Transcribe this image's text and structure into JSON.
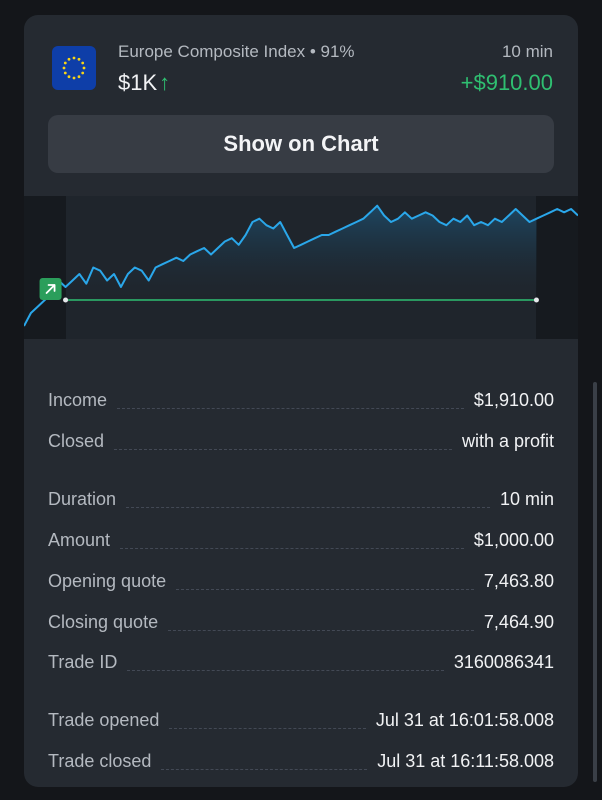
{
  "header": {
    "asset_name": "Europe Composite Index • 91%",
    "duration": "10 min",
    "amount": "$1K",
    "direction_icon": "arrow-up-icon",
    "profit": "+$910.00"
  },
  "show_chart_button": "Show on Chart",
  "chart_data": {
    "type": "line",
    "x": [
      0,
      1,
      2,
      3,
      4,
      5,
      6,
      7,
      8,
      9,
      10,
      11,
      12,
      13,
      14,
      15,
      16,
      17,
      18,
      19,
      20,
      21,
      22,
      23,
      24,
      25,
      26,
      27,
      28,
      29,
      30,
      31,
      32,
      33,
      34,
      35,
      36,
      37,
      38,
      39,
      40,
      41,
      42,
      43,
      44,
      45,
      46,
      47,
      48,
      49,
      50,
      51,
      52,
      53,
      54,
      55,
      56,
      57,
      58,
      59,
      60,
      61,
      62,
      63,
      64,
      65,
      66,
      67,
      68,
      69,
      70,
      71,
      72,
      73,
      74,
      75,
      76,
      77,
      78,
      79,
      80
    ],
    "values": [
      7463.4,
      7463.6,
      7463.7,
      7463.8,
      7463.9,
      7464.1,
      7464.0,
      7464.1,
      7464.2,
      7464.05,
      7464.3,
      7464.25,
      7464.1,
      7464.2,
      7464.0,
      7464.2,
      7464.3,
      7464.25,
      7464.1,
      7464.3,
      7464.35,
      7464.4,
      7464.45,
      7464.4,
      7464.5,
      7464.55,
      7464.6,
      7464.5,
      7464.6,
      7464.7,
      7464.75,
      7464.65,
      7464.8,
      7465.0,
      7465.05,
      7464.95,
      7464.9,
      7465.0,
      7464.8,
      7464.6,
      7464.65,
      7464.7,
      7464.75,
      7464.8,
      7464.8,
      7464.85,
      7464.9,
      7464.95,
      7465.0,
      7465.05,
      7465.15,
      7465.25,
      7465.1,
      7465.0,
      7465.05,
      7465.15,
      7465.05,
      7465.1,
      7465.15,
      7465.1,
      7465.0,
      7464.95,
      7465.05,
      7465.0,
      7465.1,
      7464.95,
      7465.0,
      7464.95,
      7465.05,
      7465.0,
      7465.1,
      7465.2,
      7465.1,
      7465.0,
      7465.05,
      7465.1,
      7465.15,
      7465.2,
      7465.15,
      7465.2,
      7465.1
    ],
    "open_index": 6,
    "close_index": 74,
    "opening_quote": 7463.8,
    "closing_quote": 7464.9,
    "ylim": [
      7463.2,
      7465.4
    ],
    "colors": {
      "line": "#2aa7ea",
      "baseline": "#2fbf71",
      "marker": "#2b9e5b"
    }
  },
  "details": {
    "income_label": "Income",
    "income_value": "$1,910.00",
    "closed_label": "Closed",
    "closed_value": "with a profit",
    "duration_label": "Duration",
    "duration_value": "10 min",
    "amount_label": "Amount",
    "amount_value": "$1,000.00",
    "opening_label": "Opening quote",
    "opening_value": "7,463.80",
    "closing_label": "Closing quote",
    "closing_value": "7,464.90",
    "tradeid_label": "Trade ID",
    "tradeid_value": "3160086341",
    "opened_label": "Trade opened",
    "opened_value": "Jul 31 at 16:01:58.008",
    "tradeclosed_label": "Trade closed",
    "tradeclosed_value": "Jul 31 at 16:11:58.008"
  },
  "icons": {
    "flag": "eu-flag-icon",
    "trade_marker": "trade-up-arrow-icon"
  }
}
